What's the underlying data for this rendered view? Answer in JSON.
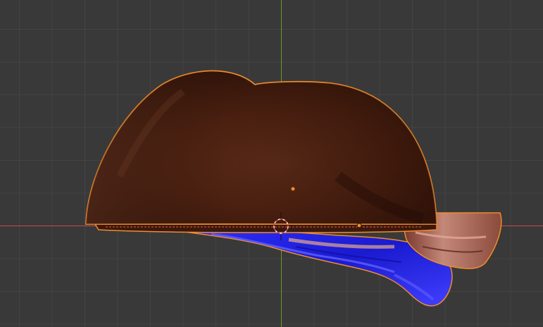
{
  "viewport": {
    "background_color": "#393939",
    "grid_color": "#444444",
    "x_axis_color": "#c44a4a",
    "y_axis_color": "#6a9a2a",
    "selection_outline_color": "#f08c2a",
    "origin_dot_color": "#f08c2a",
    "cursor_color": "#e8e8e8"
  },
  "object": {
    "body_color_light": "#6a3a22",
    "body_color_dark": "#2a1008",
    "ribbon_color": "#2828e8",
    "ribbon_highlight_color": "#6a6aff",
    "skin_color": "#c48878",
    "skin_dark_color": "#6a3028"
  }
}
